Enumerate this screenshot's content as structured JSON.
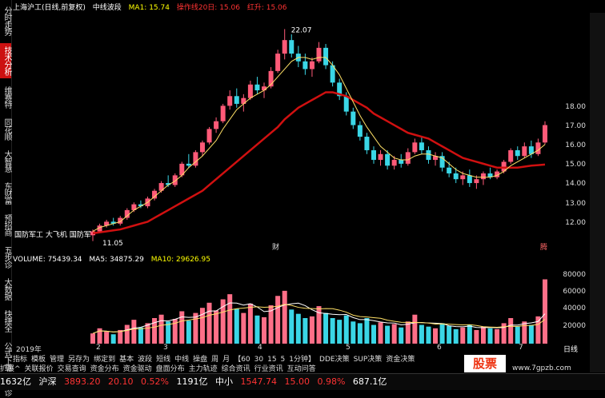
{
  "header": {
    "title": "上海沪工(日线,前复权)",
    "indicator": "中线波段",
    "ma1_label": "MA1: 15.74",
    "ma1_value": ": 15.74",
    "line1": "操作线20日: 15.06",
    "line2": "红升: 15.06"
  },
  "left_rail": [
    {
      "label": "分时走势",
      "active": false
    },
    {
      "label": "技术分析",
      "active": true
    },
    {
      "label": "维赛特",
      "active": false
    },
    {
      "label": "同花顺",
      "active": false
    },
    {
      "label": "大智慧",
      "active": false
    },
    {
      "label": "东财富",
      "active": false
    },
    {
      "label": "预招商",
      "active": false
    },
    {
      "label": "五步诊",
      "active": false
    },
    {
      "label": "大数据",
      "active": false
    },
    {
      "label": "快捷全",
      "active": false
    },
    {
      "label": "公式下载",
      "active": false
    },
    {
      "label": "君诊",
      "active": false
    }
  ],
  "price_axis": [
    "18.00",
    "17.00",
    "16.00",
    "15.00",
    "14.00",
    "13.00",
    "12.00"
  ],
  "volume_axis": [
    "80000",
    "60000",
    "40000",
    "20000"
  ],
  "annotations": {
    "high": "22.07",
    "low": "11.05",
    "news": "国防军工 大飞机 国防军",
    "tag1": "财",
    "tag2": "腾"
  },
  "volume_header": {
    "volume": "VOLUME: 75439.34",
    "mas": "MA5: 34875.29",
    "ma10": "MA10: 29626.95"
  },
  "x_axis": [
    "2019年",
    "2",
    "3",
    "4",
    "5",
    "6",
    "7"
  ],
  "period": "日线",
  "toolbar1": [
    "指标",
    "模板",
    "管理",
    "另存为",
    "绑定到",
    "基本",
    "波段",
    "短线",
    "中线",
    "操盘",
    "周",
    "月",
    "【60",
    "30",
    "15",
    "5",
    "1分钟】",
    "DDE决策",
    "SUP决策",
    "资金决策"
  ],
  "toolbar2": [
    "扩展^",
    "关联报价",
    "交易查询",
    "资金分布",
    "资金驱动",
    "盘面分布",
    "主力轨迹",
    "综合资讯",
    "行业资讯",
    "互动问答"
  ],
  "status": {
    "s1": "1632亿",
    "s2_label": "沪深",
    "s2_value": "3893.20",
    "s3": "20.10",
    "s4": "0.52%",
    "s5": "1191亿",
    "s6_label": "中小",
    "s6_value": "1547.74",
    "s7": "15.00",
    "s8": "0.98%",
    "s9": "687.1亿"
  },
  "logo": "股票",
  "watermark": "www.7gpzb.com",
  "chart_data": {
    "type": "candlestick",
    "ylim": [
      11,
      22.5
    ],
    "ohlc": [
      [
        11.4,
        11.7,
        11.1,
        11.6
      ],
      [
        11.6,
        12.0,
        11.5,
        11.9
      ],
      [
        11.9,
        12.2,
        11.8,
        12.1
      ],
      [
        12.1,
        12.3,
        11.9,
        12.0
      ],
      [
        12.0,
        12.4,
        11.9,
        12.3
      ],
      [
        12.3,
        12.8,
        12.2,
        12.7
      ],
      [
        12.7,
        13.1,
        12.6,
        13.0
      ],
      [
        13.0,
        13.2,
        12.8,
        12.9
      ],
      [
        12.9,
        13.4,
        12.8,
        13.3
      ],
      [
        13.3,
        13.8,
        13.2,
        13.7
      ],
      [
        13.7,
        14.2,
        13.6,
        14.1
      ],
      [
        14.1,
        14.5,
        13.9,
        14.0
      ],
      [
        14.0,
        14.6,
        13.9,
        14.5
      ],
      [
        14.5,
        15.2,
        14.4,
        15.1
      ],
      [
        15.1,
        15.6,
        14.9,
        15.0
      ],
      [
        15.0,
        15.8,
        14.9,
        15.7
      ],
      [
        15.7,
        16.3,
        15.5,
        16.2
      ],
      [
        16.2,
        17.0,
        16.1,
        16.9
      ],
      [
        16.9,
        17.5,
        16.7,
        17.3
      ],
      [
        17.3,
        18.2,
        17.2,
        18.1
      ],
      [
        18.1,
        18.9,
        17.9,
        18.6
      ],
      [
        18.6,
        19.0,
        18.0,
        18.2
      ],
      [
        18.2,
        18.7,
        17.8,
        18.5
      ],
      [
        18.5,
        19.4,
        18.4,
        19.2
      ],
      [
        19.2,
        19.6,
        18.7,
        18.9
      ],
      [
        18.9,
        19.3,
        18.5,
        19.1
      ],
      [
        19.1,
        20.1,
        19.0,
        19.9
      ],
      [
        19.9,
        21.0,
        19.8,
        20.8
      ],
      [
        20.8,
        22.07,
        20.5,
        21.5
      ],
      [
        21.5,
        21.8,
        20.6,
        20.8
      ],
      [
        20.8,
        21.2,
        20.1,
        20.4
      ],
      [
        20.4,
        20.8,
        19.7,
        20.0
      ],
      [
        20.0,
        20.6,
        19.6,
        20.4
      ],
      [
        20.4,
        21.4,
        20.3,
        21.1
      ],
      [
        21.1,
        21.3,
        20.0,
        20.2
      ],
      [
        20.2,
        20.4,
        19.1,
        19.3
      ],
      [
        19.3,
        19.5,
        18.4,
        18.6
      ],
      [
        18.6,
        18.8,
        17.6,
        17.8
      ],
      [
        17.8,
        18.0,
        16.9,
        17.1
      ],
      [
        17.1,
        17.3,
        16.3,
        16.5
      ],
      [
        16.5,
        16.7,
        15.6,
        15.8
      ],
      [
        15.8,
        16.0,
        15.1,
        15.3
      ],
      [
        15.3,
        15.8,
        15.0,
        15.6
      ],
      [
        15.6,
        15.8,
        14.8,
        15.0
      ],
      [
        15.0,
        15.5,
        14.8,
        15.3
      ],
      [
        15.3,
        15.6,
        14.9,
        15.1
      ],
      [
        15.1,
        15.9,
        15.0,
        15.7
      ],
      [
        15.7,
        16.4,
        15.6,
        16.2
      ],
      [
        16.2,
        16.5,
        15.6,
        15.8
      ],
      [
        15.8,
        16.0,
        15.1,
        15.3
      ],
      [
        15.3,
        15.7,
        15.0,
        15.5
      ],
      [
        15.5,
        15.7,
        14.7,
        14.9
      ],
      [
        14.9,
        15.2,
        14.4,
        14.6
      ],
      [
        14.6,
        14.9,
        14.1,
        14.3
      ],
      [
        14.3,
        14.7,
        14.0,
        14.5
      ],
      [
        14.5,
        14.8,
        13.9,
        14.1
      ],
      [
        14.1,
        14.5,
        13.8,
        14.3
      ],
      [
        14.3,
        14.7,
        14.0,
        14.6
      ],
      [
        14.6,
        14.9,
        14.3,
        14.4
      ],
      [
        14.4,
        14.8,
        14.3,
        14.7
      ],
      [
        14.7,
        15.3,
        14.6,
        15.2
      ],
      [
        15.2,
        15.9,
        15.1,
        15.8
      ],
      [
        15.8,
        16.0,
        15.3,
        15.5
      ],
      [
        15.5,
        16.2,
        15.4,
        16.0
      ],
      [
        16.0,
        16.3,
        15.4,
        15.6
      ],
      [
        15.6,
        16.4,
        15.5,
        16.2
      ],
      [
        16.2,
        17.3,
        16.1,
        17.1
      ]
    ],
    "ma1": [
      11.6,
      11.8,
      11.9,
      12.0,
      12.1,
      12.4,
      12.7,
      12.9,
      13.1,
      13.4,
      13.7,
      14.0,
      14.2,
      14.5,
      14.9,
      15.2,
      15.5,
      15.9,
      16.3,
      16.9,
      17.4,
      17.9,
      18.2,
      18.5,
      18.7,
      18.9,
      19.2,
      19.6,
      20.0,
      20.4,
      20.6,
      20.6,
      20.5,
      20.6,
      20.6,
      20.2,
      19.7,
      19.0,
      18.3,
      17.6,
      17.0,
      16.5,
      16.0,
      15.7,
      15.4,
      15.3,
      15.3,
      15.5,
      15.6,
      15.6,
      15.5,
      15.4,
      15.1,
      14.8,
      14.6,
      14.5,
      14.4,
      14.4,
      14.4,
      14.5,
      14.7,
      15.0,
      15.2,
      15.4,
      15.6,
      15.8,
      16.1
    ],
    "line20": [
      11.5,
      11.55,
      11.6,
      11.65,
      11.7,
      11.8,
      11.9,
      12.0,
      12.1,
      12.3,
      12.5,
      12.7,
      12.9,
      13.1,
      13.3,
      13.5,
      13.7,
      14.0,
      14.3,
      14.6,
      14.9,
      15.2,
      15.5,
      15.8,
      16.1,
      16.4,
      16.7,
      17.0,
      17.4,
      17.7,
      18.0,
      18.2,
      18.4,
      18.6,
      18.8,
      18.8,
      18.7,
      18.6,
      18.4,
      18.2,
      18.0,
      17.7,
      17.5,
      17.3,
      17.1,
      16.9,
      16.7,
      16.6,
      16.5,
      16.4,
      16.2,
      16.0,
      15.8,
      15.6,
      15.4,
      15.3,
      15.2,
      15.1,
      15.0,
      14.9,
      14.9,
      14.9,
      14.9,
      14.95,
      15.0,
      15.03,
      15.06
    ],
    "volume": [
      12000,
      18000,
      14000,
      11000,
      16000,
      22000,
      28000,
      19000,
      24000,
      30000,
      34000,
      26000,
      29000,
      38000,
      27000,
      36000,
      42000,
      48000,
      39000,
      52000,
      58000,
      41000,
      36000,
      47000,
      33000,
      31000,
      45000,
      56000,
      62000,
      40000,
      35000,
      30000,
      32000,
      44000,
      36000,
      30000,
      28000,
      33000,
      26000,
      24000,
      30000,
      22000,
      25000,
      21000,
      23000,
      19000,
      26000,
      34000,
      22000,
      20000,
      18000,
      24000,
      21000,
      17000,
      19000,
      22000,
      16000,
      20000,
      18000,
      17000,
      24000,
      30000,
      20000,
      26000,
      22000,
      32000,
      75439
    ]
  }
}
